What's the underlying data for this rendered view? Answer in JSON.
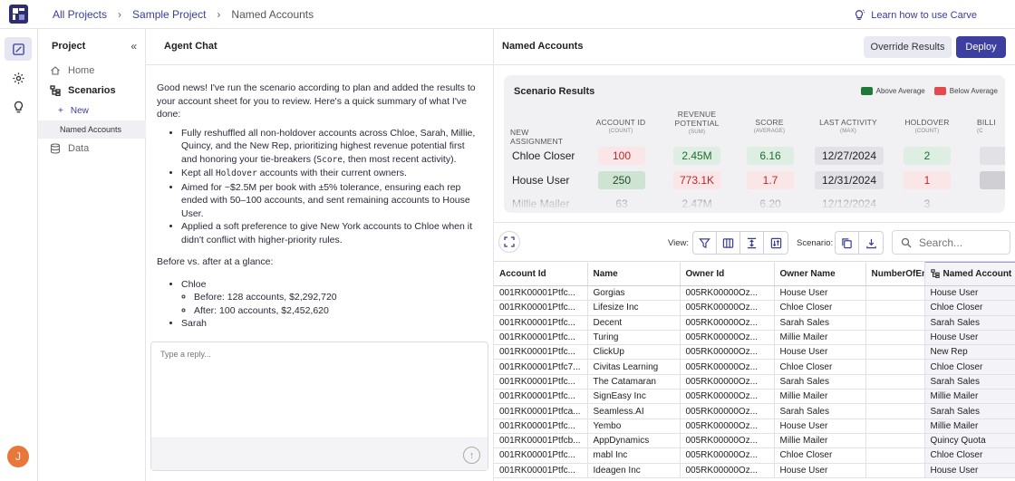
{
  "breadcrumb": {
    "items": [
      "All Projects",
      "Sample Project"
    ],
    "current": "Named Accounts"
  },
  "learn_link": "Learn how to use Carve",
  "sidebar": {
    "title": "Project",
    "items": {
      "home": "Home",
      "scenarios": "Scenarios",
      "new": "New",
      "named_accounts": "Named Accounts",
      "data": "Data"
    }
  },
  "user": {
    "avatar_initial": "J"
  },
  "chat": {
    "title": "Agent Chat",
    "intro": "Good news! I've run the scenario according to plan and added the results to your account sheet for you to review. Here's a quick summary of what I've done:",
    "bullets": {
      "b1_pre": "Fully reshuffled all non-holdover accounts across Chloe, Sarah, Millie, Quincy, and the New Rep, prioritizing highest revenue potential first and honoring your tie-breakers (",
      "b1_code": "Score",
      "b1_post": ", then most recent activity).",
      "b2_pre": "Kept all ",
      "b2_code": "Holdover",
      "b2_post": " accounts with their current owners.",
      "b3": "Aimed for ~$2.5M per book with ±5% tolerance, ensuring each rep ended with 50–100 accounts, and sent remaining accounts to House User.",
      "b4": "Applied a soft preference to give New York accounts to Chloe when it didn't conflict with higher-priority rules."
    },
    "glance_title": "Before vs. after at a glance:",
    "glance": {
      "chloe": "Chloe",
      "chloe_before": "Before: 128 accounts, $2,292,720",
      "chloe_after": "After: 100 accounts, $2,452,620",
      "sarah": "Sarah"
    },
    "reply_placeholder": "Type a reply..."
  },
  "right": {
    "title": "Named Accounts",
    "override_label": "Override Results",
    "deploy_label": "Deploy"
  },
  "results": {
    "title": "Scenario Results",
    "legend_above": "Above Average",
    "legend_below": "Below Average",
    "colors": {
      "above": "#1e7a38",
      "below": "#e5484d"
    },
    "headers": {
      "assignment": "NEW ASSIGNMENT",
      "account_id": "ACCOUNT ID",
      "account_id_sub": "(COUNT)",
      "revenue": "REVENUE POTENTIAL",
      "revenue_sub": "(SUM)",
      "score": "SCORE",
      "score_sub": "(AVERAGE)",
      "activity": "LAST ACTIVITY",
      "activity_sub": "(MAX)",
      "holdover": "HOLDOVER",
      "holdover_sub": "(COUNT)",
      "billing": "BILLI",
      "billing_sub": "(C"
    },
    "rows": [
      {
        "name": "Chloe Closer",
        "account_id": "100",
        "revenue": "2.45M",
        "score": "6.16",
        "activity": "12/27/2024",
        "holdover": "2"
      },
      {
        "name": "House User",
        "account_id": "250",
        "revenue": "773.1K",
        "score": "1.7",
        "activity": "12/31/2024",
        "holdover": "1"
      },
      {
        "name": "Millie Mailer",
        "account_id": "63",
        "revenue": "2.47M",
        "score": "6.20",
        "activity": "12/12/2024",
        "holdover": "3"
      }
    ]
  },
  "toolbar": {
    "view_label": "View:",
    "scenario_label": "Scenario:",
    "search_placeholder": "Search..."
  },
  "grid": {
    "columns": [
      "Account Id",
      "Name",
      "Owner Id",
      "Owner Name",
      "NumberOfEm",
      "Named Account"
    ],
    "rows": [
      [
        "001RK00001Ptfc...",
        "Gorgias",
        "005RK00000Oz...",
        "House User",
        "",
        "House User"
      ],
      [
        "001RK00001Ptfc...",
        "Lifesize Inc",
        "005RK00000Oz...",
        "Chloe Closer",
        "",
        "Chloe Closer"
      ],
      [
        "001RK00001Ptfc...",
        "Decent",
        "005RK00000Oz...",
        "Sarah Sales",
        "",
        "Sarah Sales"
      ],
      [
        "001RK00001Ptfc...",
        "Turing",
        "005RK00000Oz...",
        "Millie Mailer",
        "",
        "House User"
      ],
      [
        "001RK00001Ptfc...",
        "ClickUp",
        "005RK00000Oz...",
        "House User",
        "",
        "New Rep"
      ],
      [
        "001RK00001Ptfc7...",
        "Civitas Learning",
        "005RK00000Oz...",
        "Chloe Closer",
        "",
        "Chloe Closer"
      ],
      [
        "001RK00001Ptfc...",
        "The Catamaran",
        "005RK00000Oz...",
        "Sarah Sales",
        "",
        "Sarah Sales"
      ],
      [
        "001RK00001Ptfc...",
        "SignEasy Inc",
        "005RK00000Oz...",
        "Millie Mailer",
        "",
        "Millie Mailer"
      ],
      [
        "001RK00001Ptfca...",
        "Seamless.AI",
        "005RK00000Oz...",
        "Sarah Sales",
        "",
        "Sarah Sales"
      ],
      [
        "001RK00001Ptfc...",
        "Yembo",
        "005RK00000Oz...",
        "House User",
        "",
        "Millie Mailer"
      ],
      [
        "001RK00001Ptfcb...",
        "AppDynamics",
        "005RK00000Oz...",
        "Millie Mailer",
        "",
        "Quincy Quota"
      ],
      [
        "001RK00001Ptfc...",
        "mabl Inc",
        "005RK00000Oz...",
        "Chloe Closer",
        "",
        "Chloe Closer"
      ],
      [
        "001RK00001Ptfc...",
        "Ideagen Inc",
        "005RK00000Oz...",
        "House User",
        "",
        "House User"
      ]
    ]
  }
}
